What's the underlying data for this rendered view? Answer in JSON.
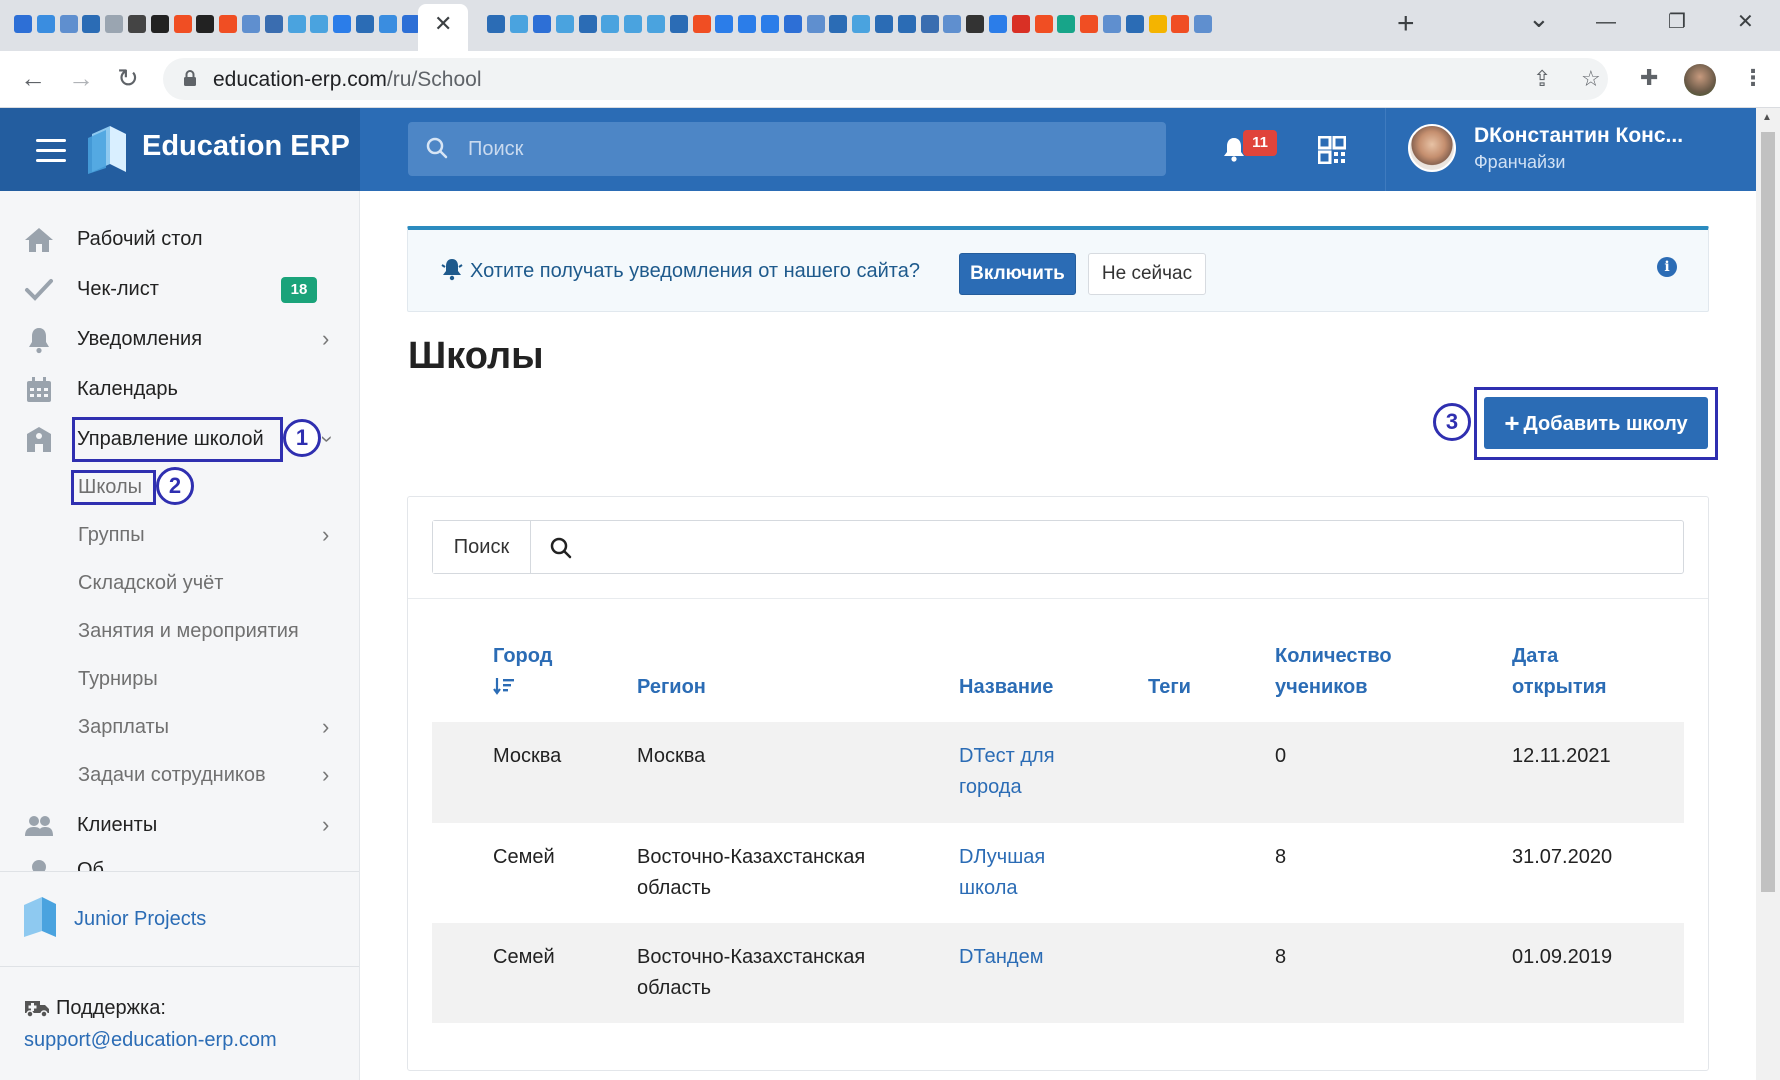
{
  "browser": {
    "tab_close": "✕",
    "new_tab": "+",
    "window_controls": {
      "tab_search": "⌄",
      "minimize": "—",
      "maximize": "❐",
      "close": "✕"
    },
    "url_host": "education-erp.com",
    "url_path": "/ru/School",
    "favicon_colors": [
      "#2d6fd6",
      "#3a8de0",
      "#5f8fcf",
      "#2b6cb5",
      "#9aa5b1",
      "#444444",
      "#222222",
      "#f04e23",
      "#222222",
      "#f04e23",
      "#5f8fcf",
      "#3a6db0",
      "#4aa3df",
      "#4aa3df",
      "#2b7de9",
      "#2b6cb5",
      "#3a8de0",
      "#2d6fd6",
      "#2b6cb5",
      "#4aa3df",
      "#2d6fd6",
      "#4aa3df",
      "#2b6cb5",
      "#4aa3df",
      "#4aa3df",
      "#4aa3df",
      "#2b6cb5",
      "#f04e23",
      "#2b7de9",
      "#2b7de9",
      "#2b7de9",
      "#2d6fd6",
      "#5f8fcf",
      "#2b6cb5",
      "#4aa3df",
      "#2b6cb5",
      "#2b6cb5",
      "#3a6db0",
      "#5f8fcf",
      "#333333",
      "#2b7de9",
      "#d93025",
      "#f04e23",
      "#17a589",
      "#f04e23",
      "#5f8fcf",
      "#2b6cb5",
      "#f4b400",
      "#f04e23",
      "#5f8fcf"
    ]
  },
  "header": {
    "brand": "Education ERP",
    "search_placeholder": "Поиск",
    "notifications_count": "11",
    "user_name": "DКонстантин Конс...",
    "user_role": "Франчайзи"
  },
  "sidebar": {
    "items": [
      {
        "label": "Рабочий стол",
        "icon": "home-icon"
      },
      {
        "label": "Чек-лист",
        "icon": "check-icon",
        "badge": "18"
      },
      {
        "label": "Уведомления",
        "icon": "bell-icon"
      },
      {
        "label": "Календарь",
        "icon": "calendar-icon"
      },
      {
        "label": "Управление школой",
        "icon": "school-icon"
      },
      {
        "label": "Клиенты",
        "icon": "users-icon"
      }
    ],
    "subitems": [
      {
        "label": "Школы"
      },
      {
        "label": "Группы"
      },
      {
        "label": "Складской учёт"
      },
      {
        "label": "Занятия и мероприятия"
      },
      {
        "label": "Турниры"
      },
      {
        "label": "Зарплаты"
      },
      {
        "label": "Задачи сотрудников"
      }
    ],
    "partial_item": "Об",
    "junior_projects": "Junior Projects",
    "support_label": "Поддержка:",
    "support_email": "support@education-erp.com"
  },
  "annotations": [
    "1",
    "2",
    "3"
  ],
  "notification": {
    "text": "Хотите получать уведомления от нашего сайта?",
    "enable_button": "Включить",
    "later_button": "Не сейчас",
    "info_symbol": "i"
  },
  "page": {
    "title": "Школы",
    "add_button": "Добавить школу"
  },
  "table": {
    "search_label": "Поиск",
    "columns": [
      {
        "line1": "Город",
        "line2": ""
      },
      {
        "line1": "",
        "line2": "Регион"
      },
      {
        "line1": "",
        "line2": "Название"
      },
      {
        "line1": "",
        "line2": "Теги"
      },
      {
        "line1": "Количество",
        "line2": "учеников"
      },
      {
        "line1": "Дата",
        "line2": "открытия"
      }
    ],
    "rows": [
      {
        "city": "Москва",
        "region_l1": "Москва",
        "region_l2": "",
        "name_l1": "DТест для",
        "name_l2": "города",
        "tags": "",
        "students": "0",
        "opened": "12.11.2021"
      },
      {
        "city": "Семей",
        "region_l1": "Восточно-Казахстанская",
        "region_l2": "область",
        "name_l1": "DЛучшая",
        "name_l2": "школа",
        "tags": "",
        "students": "8",
        "opened": "31.07.2020"
      },
      {
        "city": "Семей",
        "region_l1": "Восточно-Казахстанская",
        "region_l2": "область",
        "name_l1": "DТандем",
        "name_l2": "",
        "tags": "",
        "students": "8",
        "opened": "01.09.2019"
      }
    ]
  },
  "colors": {
    "header_blue": "#2b6cb5",
    "brand_blue": "#235d9f",
    "annotation": "#2f2fb0",
    "badge_green": "#1aa37a",
    "badge_red": "#e0443b"
  }
}
